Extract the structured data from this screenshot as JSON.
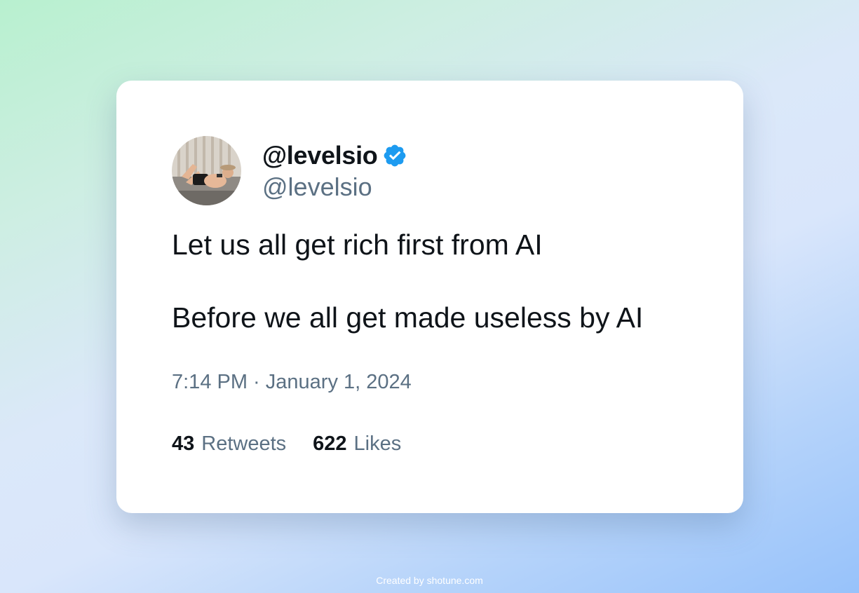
{
  "tweet": {
    "display_name": "@levelsio",
    "handle": "@levelsio",
    "verified": true,
    "avatar_icon": "user-photo-avatar",
    "text_lines": [
      "Let us all get rich first from AI",
      "Before we all get made useless by AI"
    ],
    "timestamp": "7:14 PM · January 1, 2024",
    "retweets_count": "43",
    "retweets_label": "Retweets",
    "likes_count": "622",
    "likes_label": "Likes"
  },
  "footer": {
    "credit": "Created by shotune.com"
  },
  "colors": {
    "verified_badge": "#1d9bf0",
    "secondary_text": "#5b7083",
    "primary_text": "#0f1419"
  }
}
